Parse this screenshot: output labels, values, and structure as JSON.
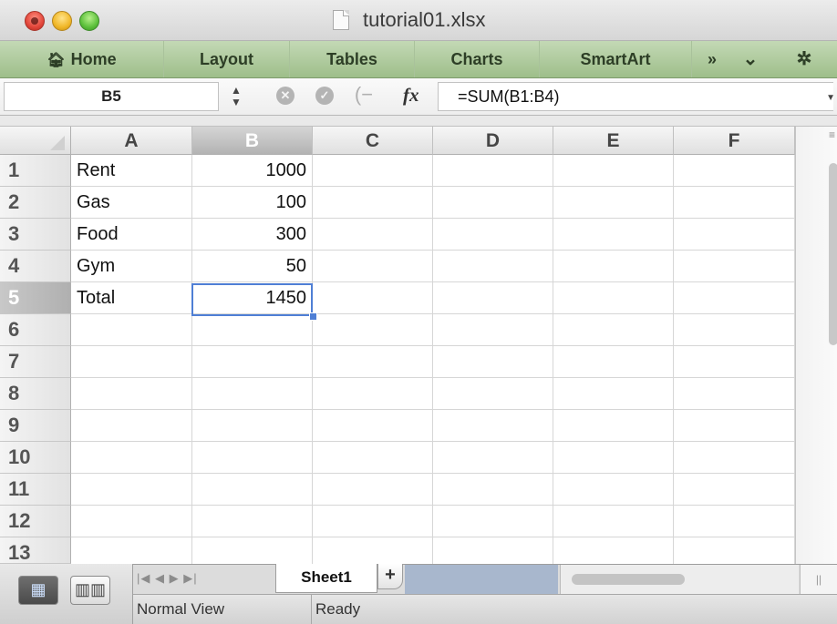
{
  "window": {
    "title": "tutorial01.xlsx"
  },
  "ribbon": {
    "tabs": [
      "Home",
      "Layout",
      "Tables",
      "Charts",
      "SmartArt"
    ],
    "overflow_glyph": "»",
    "collapse_glyph": "⌄",
    "settings_glyph": "✲"
  },
  "formula_bar": {
    "name_box": "B5",
    "fx_label": "fx",
    "formula": "=SUM(B1:B4)"
  },
  "grid": {
    "columns": [
      "A",
      "B",
      "C",
      "D",
      "E",
      "F"
    ],
    "selected_column": "B",
    "rows": [
      "1",
      "2",
      "3",
      "4",
      "5",
      "6",
      "7",
      "8",
      "9",
      "10",
      "11",
      "12",
      "13"
    ],
    "selected_row": "5",
    "cells": {
      "A1": "Rent",
      "B1": "1000",
      "A2": "Gas",
      "B2": "100",
      "A3": "Food",
      "B3": "300",
      "A4": "Gym",
      "B4": "50",
      "A5": "Total",
      "B5": "1450"
    },
    "active_cell": "B5"
  },
  "sheets": {
    "tabs": [
      "Sheet1"
    ],
    "add_label": "+"
  },
  "status": {
    "view": "Normal View",
    "state": "Ready"
  },
  "colors": {
    "ribbon": "#a9c694",
    "selection": "#4f7fd5",
    "sheet_fill": "#a8b7cd"
  }
}
